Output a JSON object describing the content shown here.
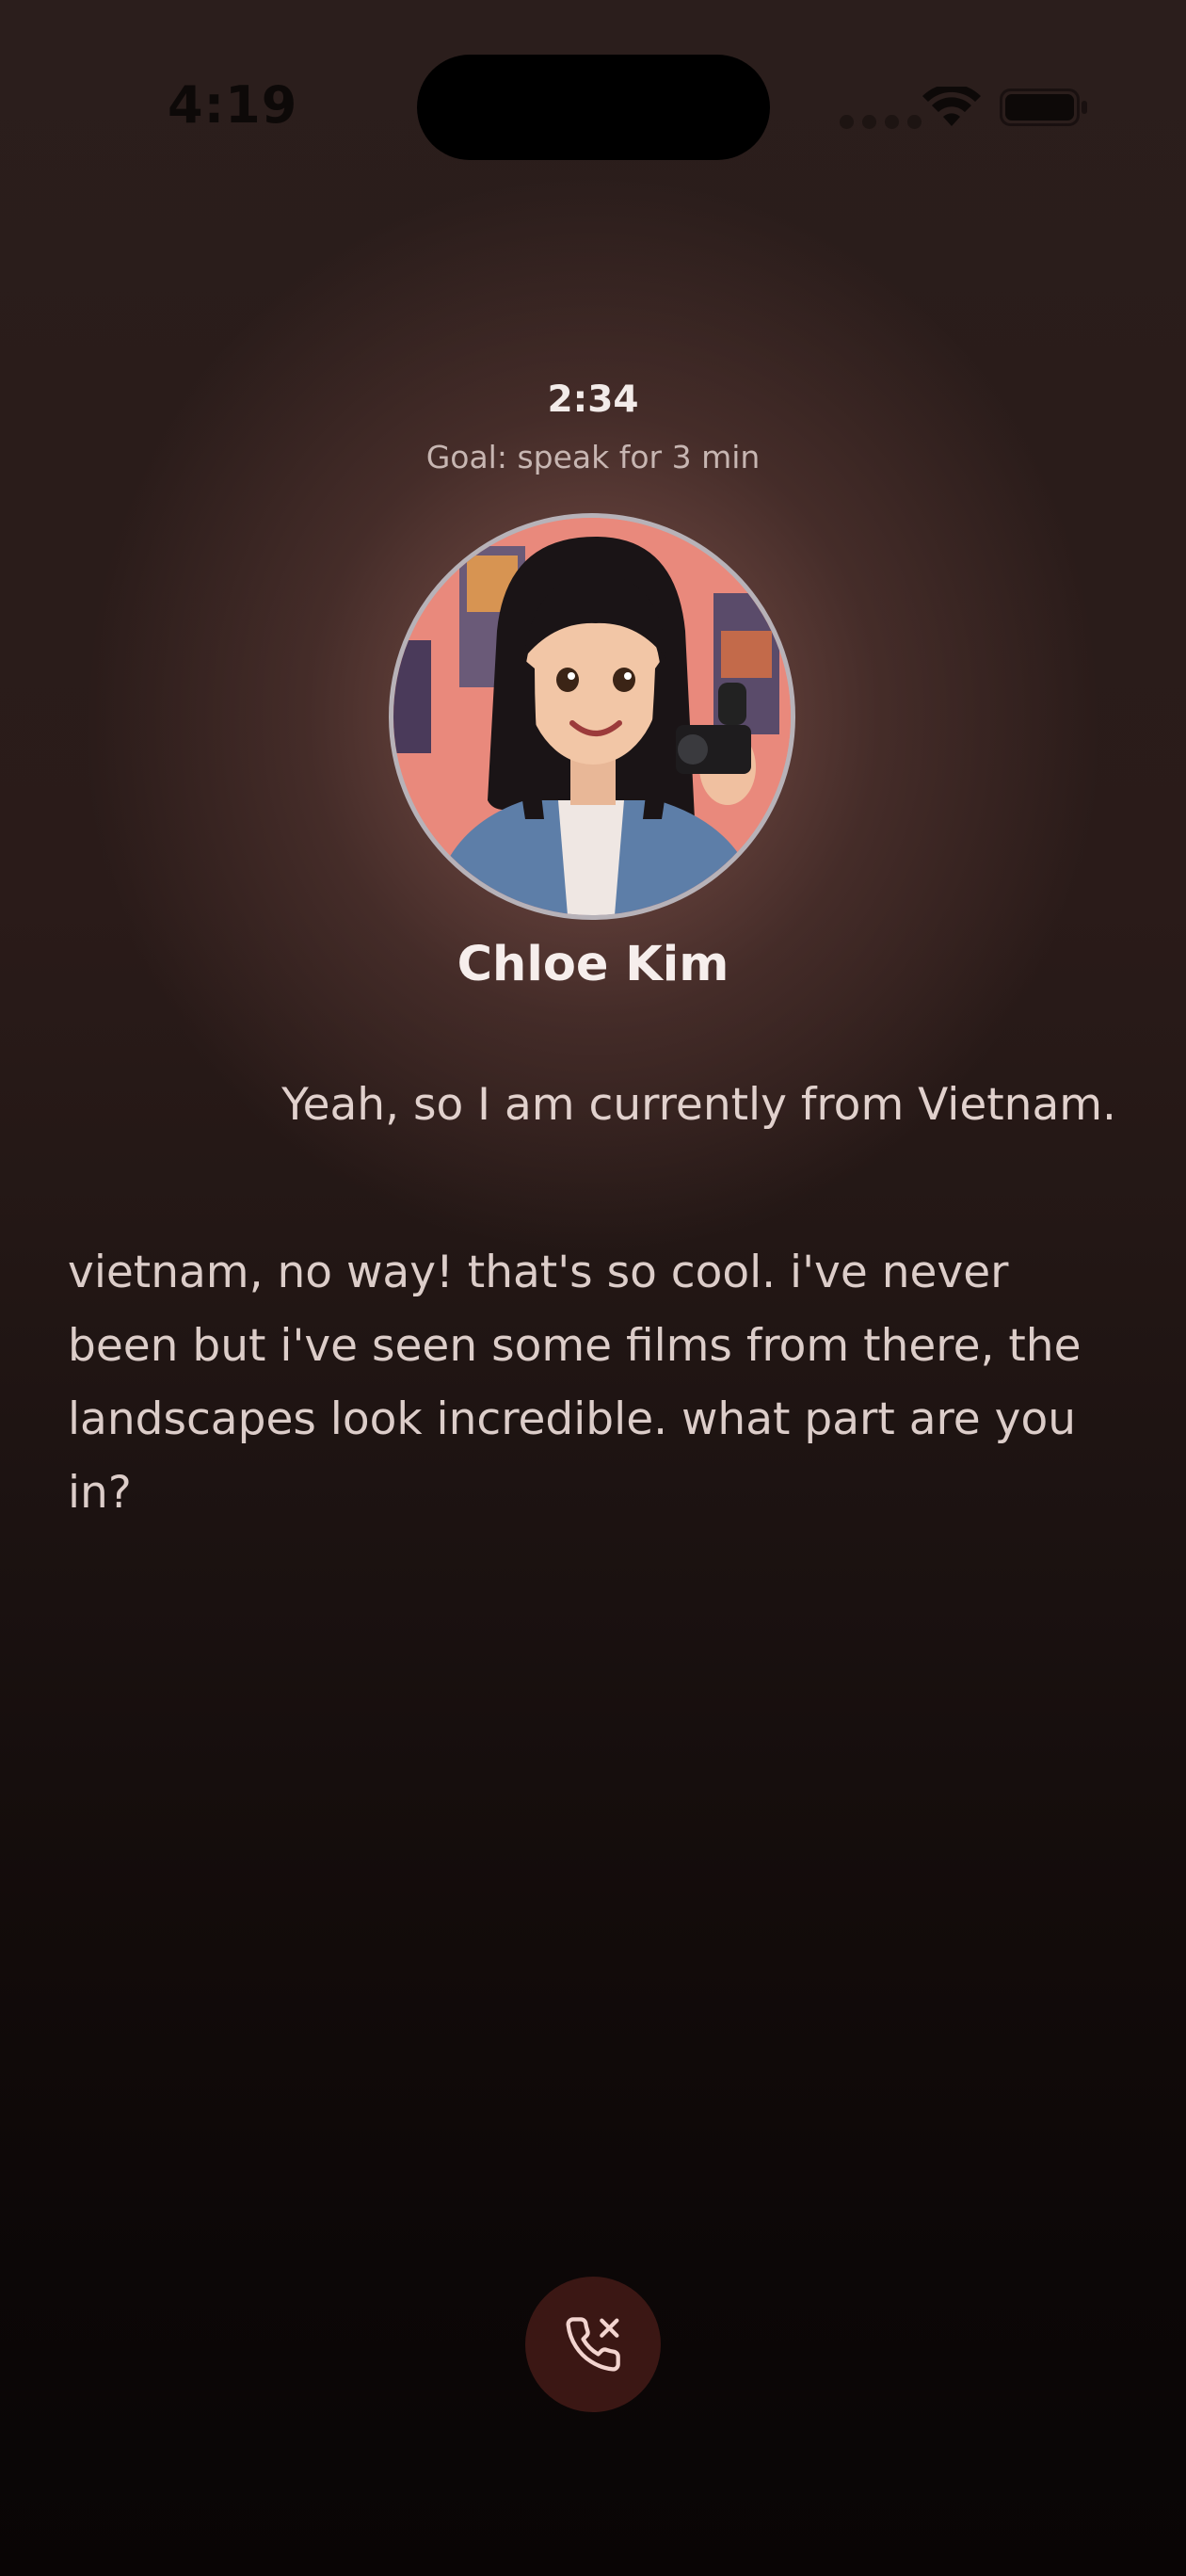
{
  "status_bar": {
    "time": "4:19"
  },
  "call": {
    "timer": "2:34",
    "goal": "Goal: speak for 3 min",
    "contact_name": "Chloe Kim",
    "avatar": "avatar-icon"
  },
  "transcript": {
    "user_message": "Yeah, so I am currently from Vietnam.",
    "ai_message": "vietnam, no way! that's so cool. i've never been but i've seen some films from there, the landscapes look incredible. what part are you in?"
  },
  "controls": {
    "end_call_icon": "phone-x-icon",
    "end_call_color": "#3b1714"
  },
  "colors": {
    "accent_icon": "#f3d4cf",
    "background_top": "#2b1e1c",
    "background_bottom": "#090505"
  }
}
